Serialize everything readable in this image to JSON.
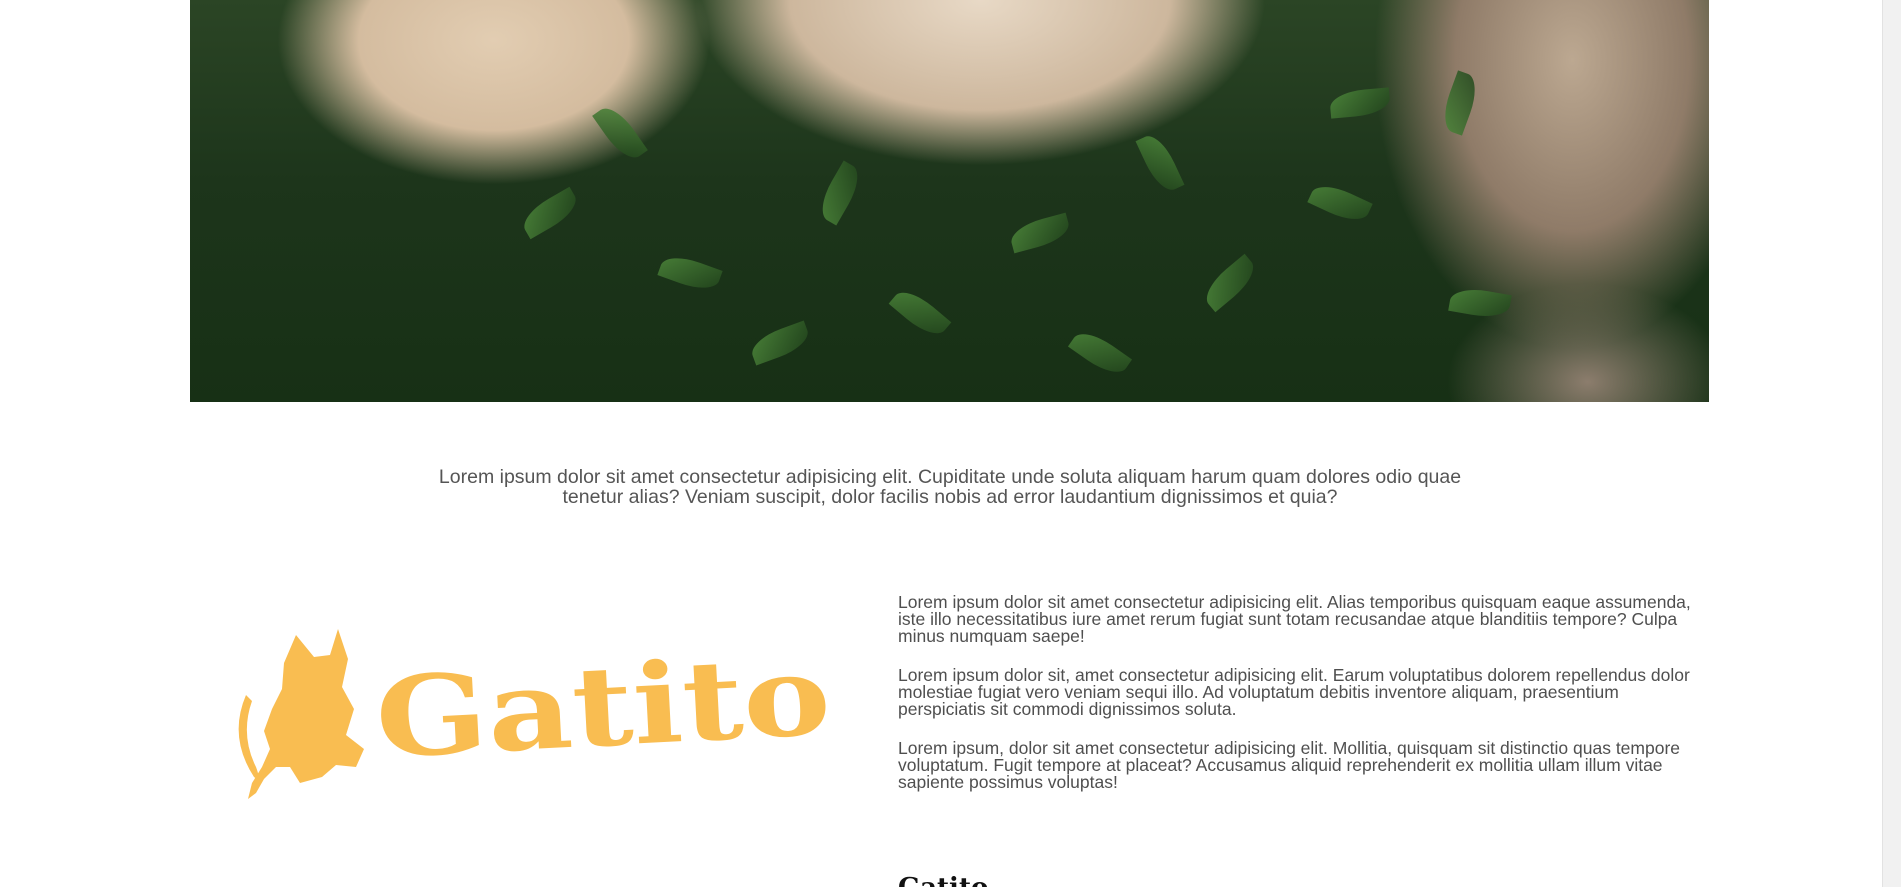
{
  "hero": {
    "image_name": "dog-and-cat-in-grass-photo"
  },
  "intro": {
    "text": "Lorem ipsum dolor sit amet consectetur adipisicing elit. Cupiditate unde soluta aliquam harum quam dolores odio quae tenetur alias? Veniam suscipit, dolor facilis nobis ad error laudantium dignissimos et quia?"
  },
  "brand": {
    "name": "Gatito",
    "color": "#f9bd51",
    "icon": "cat-icon"
  },
  "content": {
    "paragraphs": [
      "Lorem ipsum dolor sit amet consectetur adipisicing elit. Alias temporibus quisquam eaque assumenda, iste illo necessitatibus iure amet rerum fugiat sunt totam recusandae atque blanditiis tempore? Culpa minus numquam saepe!",
      "Lorem ipsum dolor sit, amet consectetur adipisicing elit. Earum voluptatibus dolorem repellendus dolor molestiae fugiat vero veniam sequi illo. Ad voluptatum debitis inventore aliquam, praesentium perspiciatis sit commodi dignissimos soluta.",
      "Lorem ipsum, dolor sit amet consectetur adipisicing elit. Mollitia, quisquam sit distinctio quas tempore voluptatum. Fugit tempore at placeat? Accusamus aliquid reprehenderit ex mollitia ullam illum vitae sapiente possimus voluptas!"
    ]
  }
}
